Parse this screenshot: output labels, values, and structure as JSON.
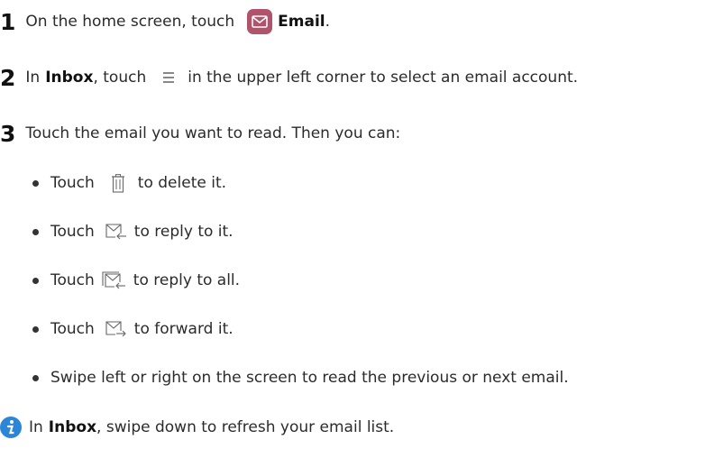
{
  "steps": [
    {
      "number": "1",
      "pre": "On the home screen, touch",
      "bold": "Email",
      "post": ".",
      "icon": "email-app-icon"
    },
    {
      "number": "2",
      "pre": "In",
      "bold": "Inbox",
      "mid": ", touch",
      "post": "in the upper left corner to select an email account.",
      "icon": "menu-icon"
    },
    {
      "number": "3",
      "text": "Touch the email you want to read. Then you can:"
    }
  ],
  "actions": [
    {
      "pre": "Touch",
      "post": "to delete it.",
      "icon": "trash-icon"
    },
    {
      "pre": "Touch",
      "post": "to reply to it.",
      "icon": "reply-icon"
    },
    {
      "pre": "Touch",
      "post": "to reply to all.",
      "icon": "reply-all-icon"
    },
    {
      "pre": "Touch",
      "post": "to forward it.",
      "icon": "forward-icon"
    },
    {
      "text": "Swipe left or right on the screen to read the previous or next email."
    }
  ],
  "note": {
    "icon": "info-icon",
    "pre": "In",
    "bold": "Inbox",
    "post": ", swipe down to refresh your email list."
  },
  "colors": {
    "email_app_icon": "#b0546b",
    "info_icon": "#2b86d8"
  }
}
